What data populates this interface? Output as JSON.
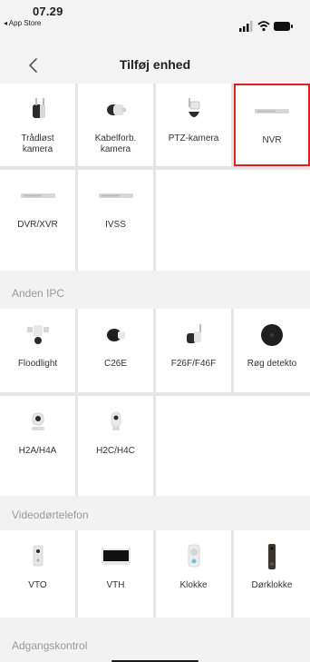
{
  "status_bar": {
    "time": "07.29",
    "back_app": "◂ App Store",
    "icons": [
      "signal-icon",
      "wifi-icon",
      "battery-icon"
    ]
  },
  "nav": {
    "back_icon": "chevron-left-icon",
    "title": "Tilføj enhed"
  },
  "top_group": {
    "items": [
      {
        "label": "Trådløst\nkamera",
        "icon": "wireless-camera-icon"
      },
      {
        "label": "Kabelforb.\nkamera",
        "icon": "wired-camera-icon"
      },
      {
        "label": "PTZ-kamera",
        "icon": "ptz-camera-icon"
      },
      {
        "label": "NVR",
        "icon": "nvr-icon",
        "selected": true
      },
      {
        "label": "DVR/XVR",
        "icon": "dvr-icon"
      },
      {
        "label": "IVSS",
        "icon": "ivss-icon"
      }
    ]
  },
  "section_ipc": {
    "title": "Anden IPC",
    "items": [
      {
        "label": "Floodlight",
        "icon": "floodlight-camera-icon"
      },
      {
        "label": "C26E",
        "icon": "bullet-camera-icon"
      },
      {
        "label": "F26F/F46F",
        "icon": "outdoor-camera-icon"
      },
      {
        "label": "Røg detekto",
        "icon": "smoke-detector-icon"
      },
      {
        "label": "H2A/H4A",
        "icon": "indoor-camera-icon"
      },
      {
        "label": "H2C/H4C",
        "icon": "mini-camera-icon"
      }
    ]
  },
  "section_video": {
    "title": "Videodørtelefon",
    "items": [
      {
        "label": "VTO",
        "icon": "door-station-icon"
      },
      {
        "label": "VTH",
        "icon": "indoor-monitor-icon"
      },
      {
        "label": "Klokke",
        "icon": "chime-icon"
      },
      {
        "label": "Dørklokke",
        "icon": "doorbell-icon"
      }
    ]
  },
  "section_access": {
    "title": "Adgangskontrol"
  },
  "colors": {
    "selected_border": "#e02020",
    "divider": "#e5e5e5",
    "section_text": "#9a9a9a"
  }
}
